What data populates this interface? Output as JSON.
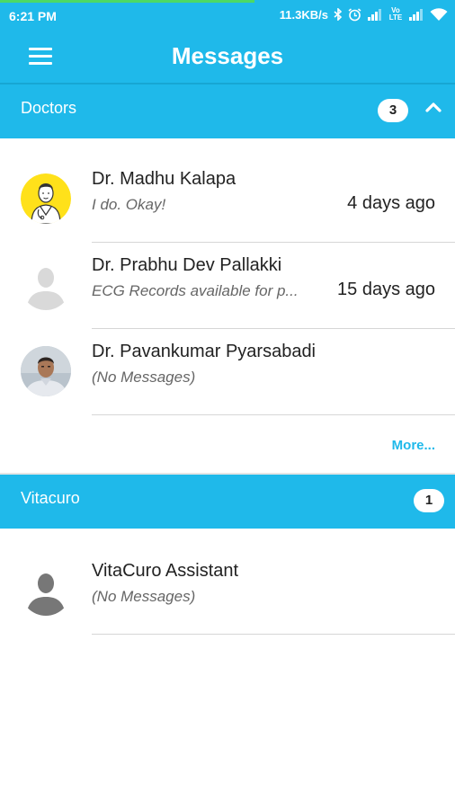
{
  "status_bar": {
    "time": "6:21 PM",
    "network_speed": "11.3KB/s",
    "icons": [
      "bluetooth-icon",
      "alarm-icon",
      "signal-icon",
      "volte-icon",
      "signal-icon",
      "wifi-icon"
    ],
    "lte_label": "Vo LTE"
  },
  "app_bar": {
    "title": "Messages",
    "menu_icon": "hamburger-menu-icon"
  },
  "sections": [
    {
      "label": "Doctors",
      "count": "3",
      "expanded": true,
      "contacts": [
        {
          "name": "Dr. Madhu Kalapa",
          "message": "I do. Okay!",
          "time": "4 days ago",
          "avatar": "doctor-cartoon-avatar"
        },
        {
          "name": "Dr. Prabhu Dev Pallakki",
          "message": "ECG Records available for p...",
          "time": "15 days ago",
          "avatar": "default-person-avatar"
        },
        {
          "name": "Dr. Pavankumar Pyarsabadi",
          "message": "(No Messages)",
          "time": "",
          "avatar": "photo-avatar"
        }
      ],
      "more_label": "More..."
    },
    {
      "label": "Vitacuro",
      "count": "1",
      "contacts": [
        {
          "name": "VitaCuro Assistant",
          "message": "(No Messages)",
          "time": "",
          "avatar": "default-person-avatar"
        }
      ]
    }
  ],
  "colors": {
    "primary": "#1fb9ea",
    "link": "#1fb9ea",
    "divider": "#d6d6d6"
  }
}
